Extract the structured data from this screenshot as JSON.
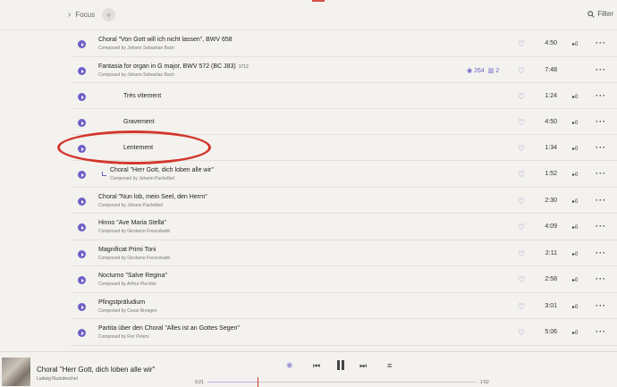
{
  "topbar": {
    "focus_label": "Focus",
    "filter_label": "Filter"
  },
  "tracks": [
    {
      "title": "Choral \"Von Gott will ich nicht lassen\", BWV 658",
      "composer": "Composed by Johann Sebastian Bach",
      "duration": "4:50",
      "plays": "0",
      "type": "work"
    },
    {
      "title": "Fantasia for organ in G major, BWV 572 (BC J83)",
      "year": "1712",
      "composer": "Composed by Johann Sebastian Bach",
      "duration": "7:48",
      "views": "264",
      "movements": "2",
      "type": "work-header"
    },
    {
      "title": "Très vitement",
      "duration": "1:24",
      "plays": "0",
      "type": "movement"
    },
    {
      "title": "Gravement",
      "duration": "4:50",
      "plays": "0",
      "type": "movement"
    },
    {
      "title": "Lentement",
      "duration": "1:34",
      "plays": "0",
      "type": "movement-highlighted"
    },
    {
      "title": "Choral \"Herr Gott, dich loben alle wir\"",
      "composer": "Composed by Johann Pachelbel",
      "duration": "1:52",
      "plays": "0",
      "type": "work-current"
    },
    {
      "title": "Choral \"Nun lob, mein Seel, den Herrn\"",
      "composer": "Composed by Johann Pachelbel",
      "duration": "2:30",
      "plays": "0",
      "type": "work"
    },
    {
      "title": "Hinno \"Ave Maria Stella\"",
      "composer": "Composed by Girolamo Frescobaldi",
      "duration": "4:09",
      "plays": "0",
      "type": "work"
    },
    {
      "title": "Magnificat Primi Toni",
      "composer": "Composed by Girolamo Frescobaldi",
      "duration": "2:11",
      "plays": "0",
      "type": "work"
    },
    {
      "title": "Nocturno \"Salve Regina\"",
      "composer": "Composed by Arthur Piechler",
      "duration": "2:58",
      "plays": "0",
      "type": "work"
    },
    {
      "title": "Pfingstpräludium",
      "composer": "Composed by Cesar Bresgen",
      "duration": "3:01",
      "plays": "0",
      "type": "work"
    },
    {
      "title": "Partita über den Choral \"Alles ist an Gottes Segen\"",
      "composer": "Composed by Flor Peters",
      "duration": "5:06",
      "plays": "0",
      "type": "work"
    }
  ],
  "player": {
    "title": "Choral \"Herr Gott, dich loben alle wir\"",
    "artist": "Ludwig Ruckdeschel",
    "elapsed": "0:21",
    "total": "1:52",
    "progress": 0.1875
  },
  "colors": {
    "accent": "#6e60c7",
    "highlight": "#d2372e",
    "background": "#f4f2ee"
  },
  "icons": {
    "focus": "chevron-right-icon",
    "favorite": "heart-icon",
    "filter": "search-icon",
    "more": "more-dots-icon"
  }
}
